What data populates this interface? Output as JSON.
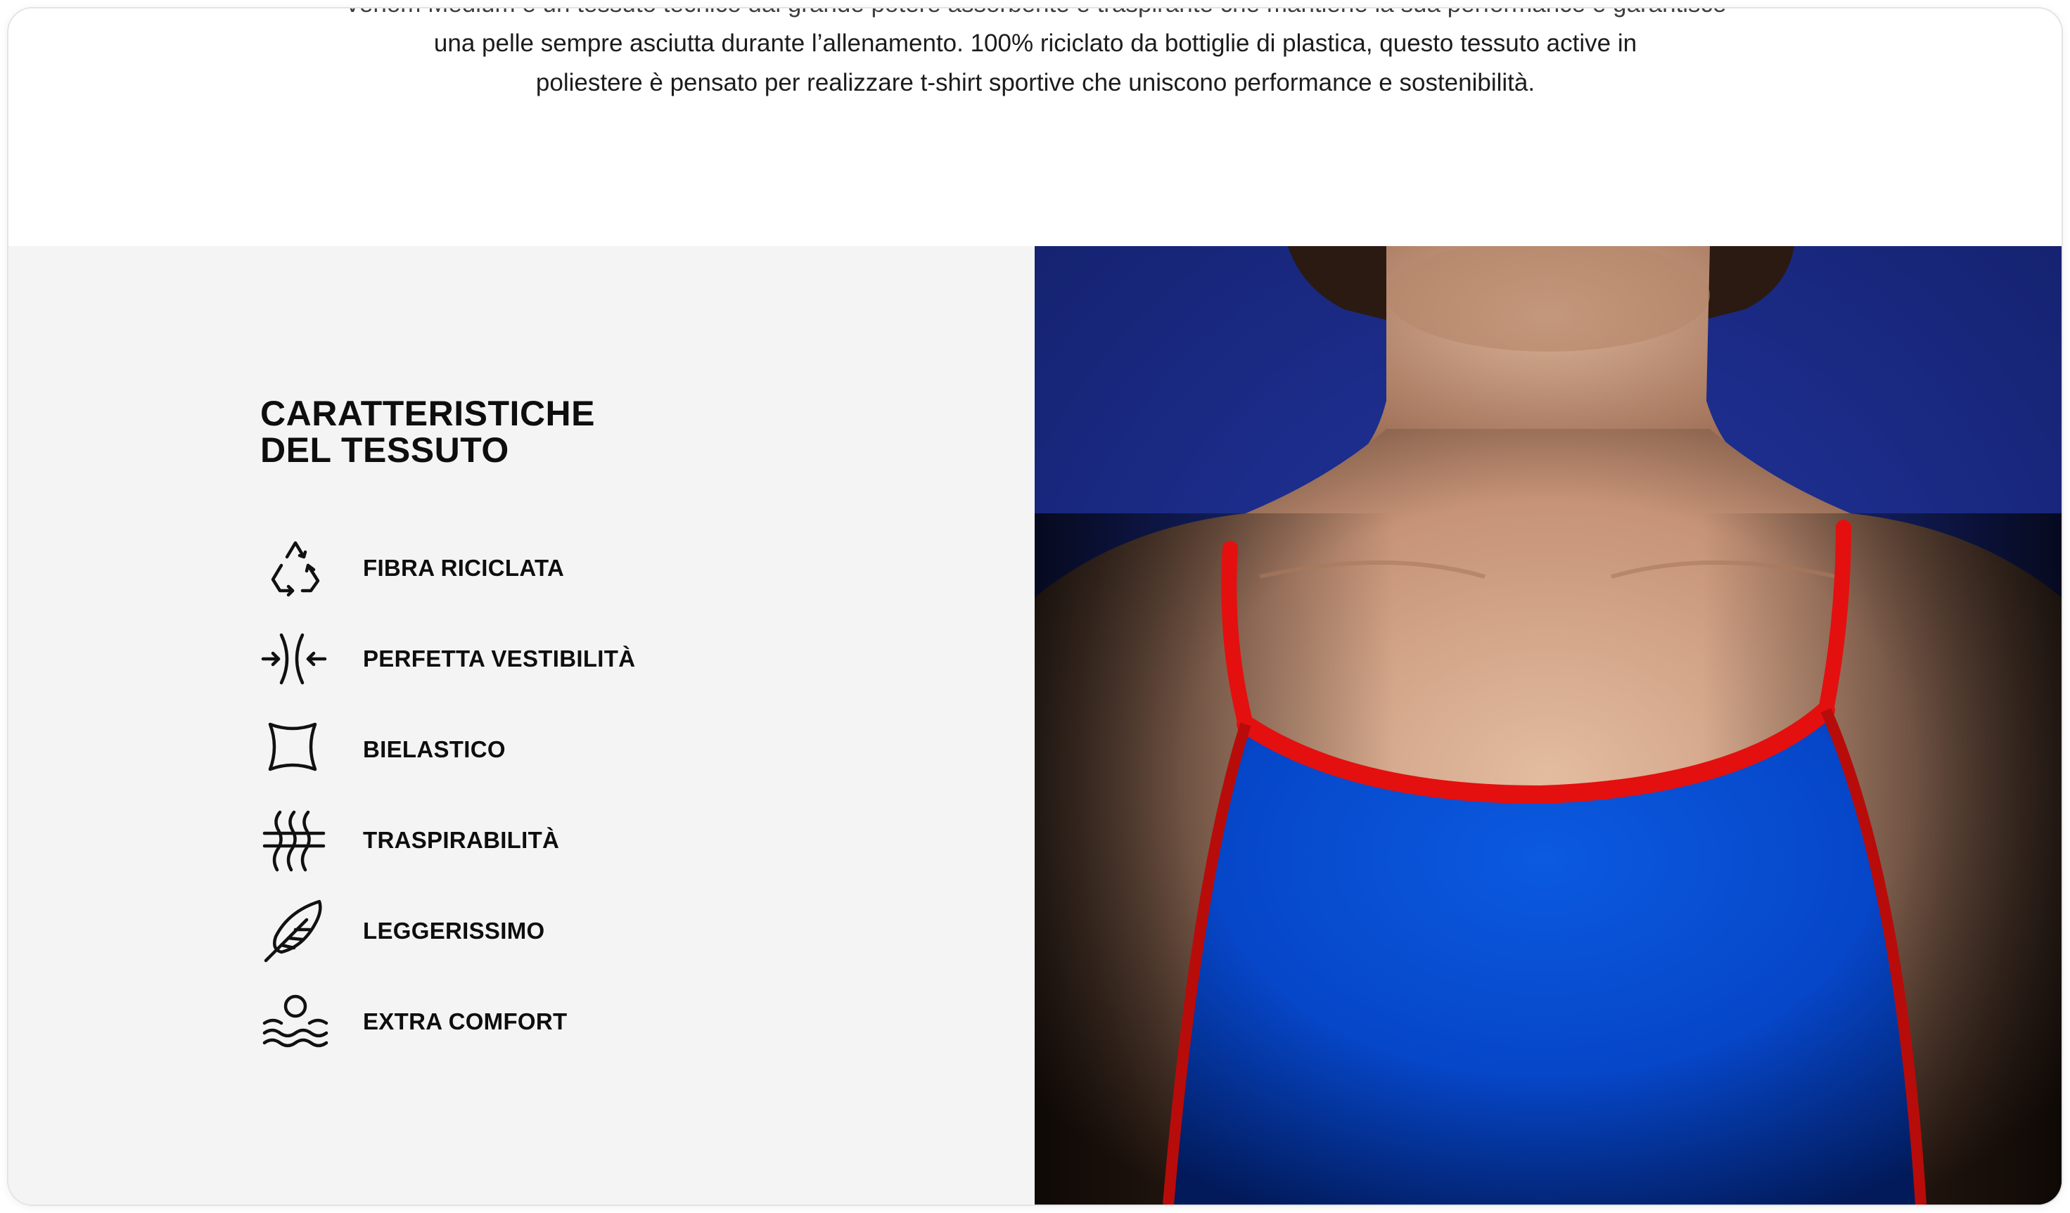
{
  "intro": {
    "cut_line": "Venom Medium è un tessuto tecnico dal grande potere assorbente e traspirante che mantiene la sua performance e garantisce",
    "line1": "una pelle sempre asciutta durante l’allenamento. 100% riciclato da bottiglie di plastica, questo tessuto active in",
    "line2": "poliestere è pensato per realizzare t-shirt sportive che uniscono performance e sostenibilità."
  },
  "features": {
    "heading_line1": "CARATTERISTICHE",
    "heading_line2": "DEL TESSUTO",
    "items": [
      {
        "icon": "recycle-icon",
        "label": "FIBRA RICICLATA"
      },
      {
        "icon": "fit-arrows-icon",
        "label": "PERFETTA VESTIBILITÀ"
      },
      {
        "icon": "bi-stretch-square-icon",
        "label": "BIELASTICO"
      },
      {
        "icon": "breathable-waves-icon",
        "label": "TRASPIRABILITÀ"
      },
      {
        "icon": "feather-icon",
        "label": "LEGGERISSIMO"
      },
      {
        "icon": "comfort-float-icon",
        "label": "EXTRA COMFORT"
      }
    ]
  },
  "photo": {
    "subject": "model-wearing-blue-swimsuit-with-red-trim",
    "colors": {
      "background": "#1b2d8e",
      "fabric": "#0a4fd6",
      "trim": "#e3100f",
      "skin": "#c79b7c"
    }
  }
}
